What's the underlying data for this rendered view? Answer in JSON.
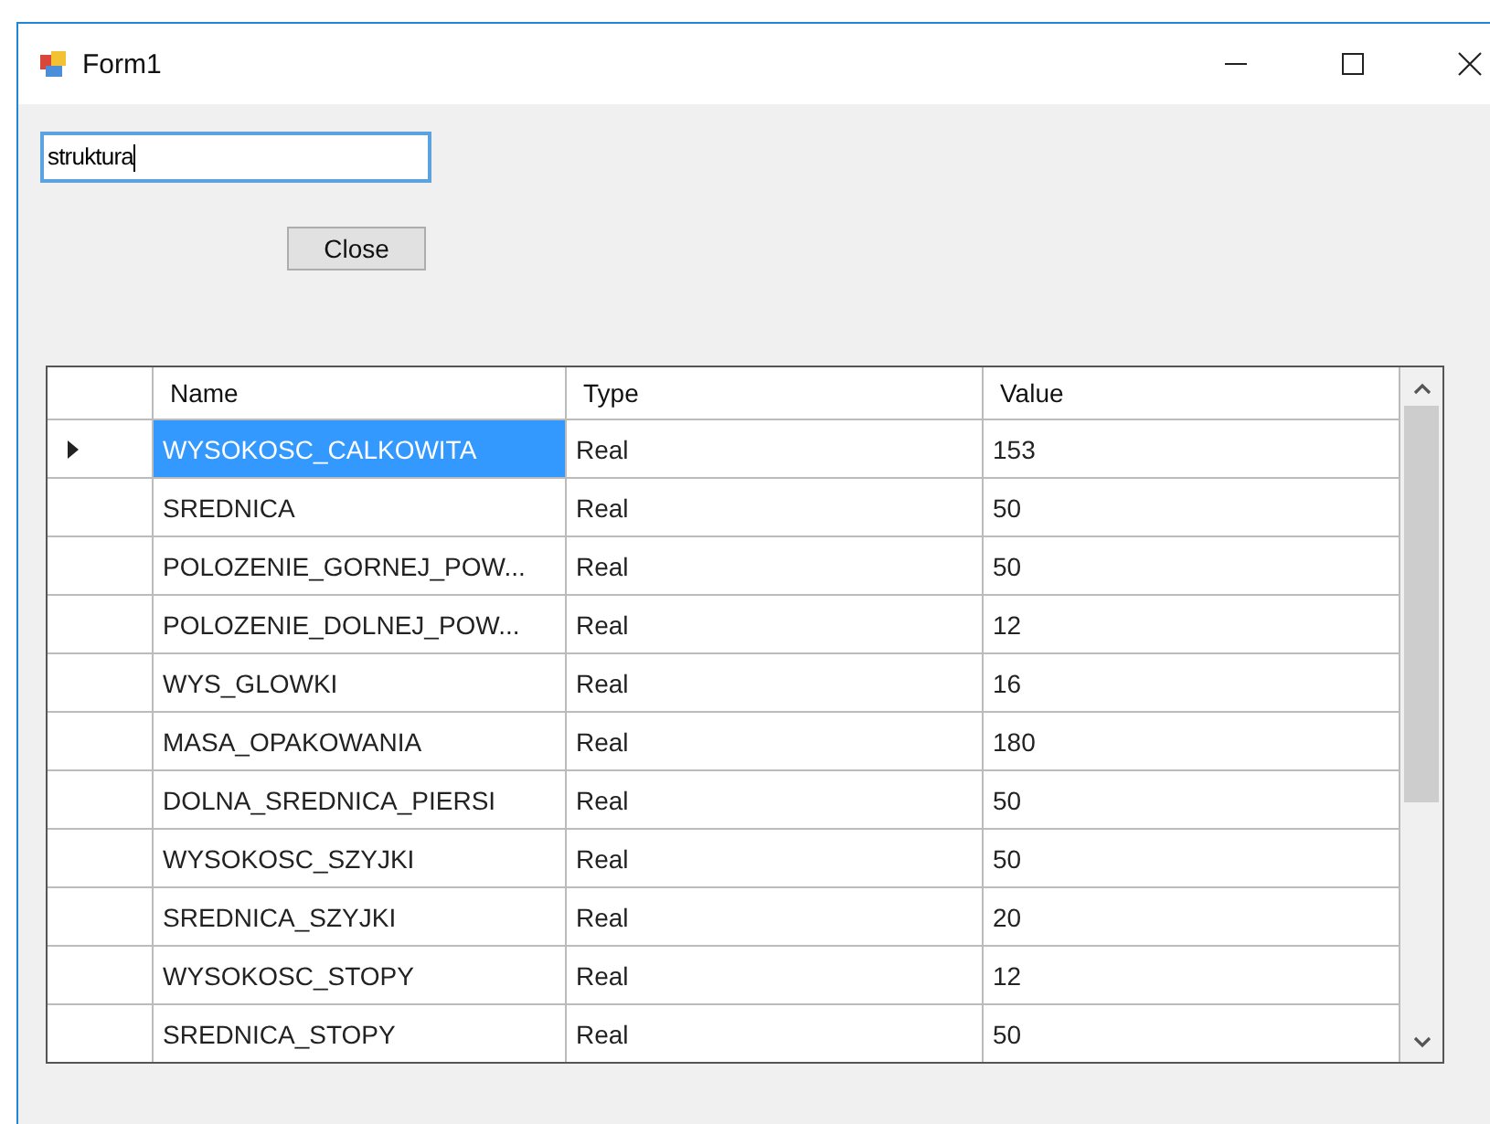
{
  "window": {
    "title": "Form1"
  },
  "text_field": {
    "value": "struktura"
  },
  "close_button": {
    "label": "Close"
  },
  "table": {
    "columns": [
      "Name",
      "Type",
      "Value"
    ],
    "rows": [
      {
        "selected": true,
        "cells": [
          "WYSOKOSC_CALKOWITA",
          "Real",
          "153"
        ]
      },
      {
        "selected": false,
        "cells": [
          "SREDNICA",
          "Real",
          "50"
        ]
      },
      {
        "selected": false,
        "cells": [
          "POLOZENIE_GORNEJ_POW...",
          "Real",
          "50"
        ]
      },
      {
        "selected": false,
        "cells": [
          "POLOZENIE_DOLNEJ_POW...",
          "Real",
          "12"
        ]
      },
      {
        "selected": false,
        "cells": [
          "WYS_GLOWKI",
          "Real",
          "16"
        ]
      },
      {
        "selected": false,
        "cells": [
          "MASA_OPAKOWANIA",
          "Real",
          "180"
        ]
      },
      {
        "selected": false,
        "cells": [
          "DOLNA_SREDNICA_PIERSI",
          "Real",
          "50"
        ]
      },
      {
        "selected": false,
        "cells": [
          "WYSOKOSC_SZYJKI",
          "Real",
          "50"
        ]
      },
      {
        "selected": false,
        "cells": [
          "SREDNICA_SZYJKI",
          "Real",
          "20"
        ]
      },
      {
        "selected": false,
        "cells": [
          "WYSOKOSC_STOPY",
          "Real",
          "12"
        ]
      },
      {
        "selected": false,
        "cells": [
          "SREDNICA_STOPY",
          "Real",
          "50"
        ]
      }
    ]
  }
}
